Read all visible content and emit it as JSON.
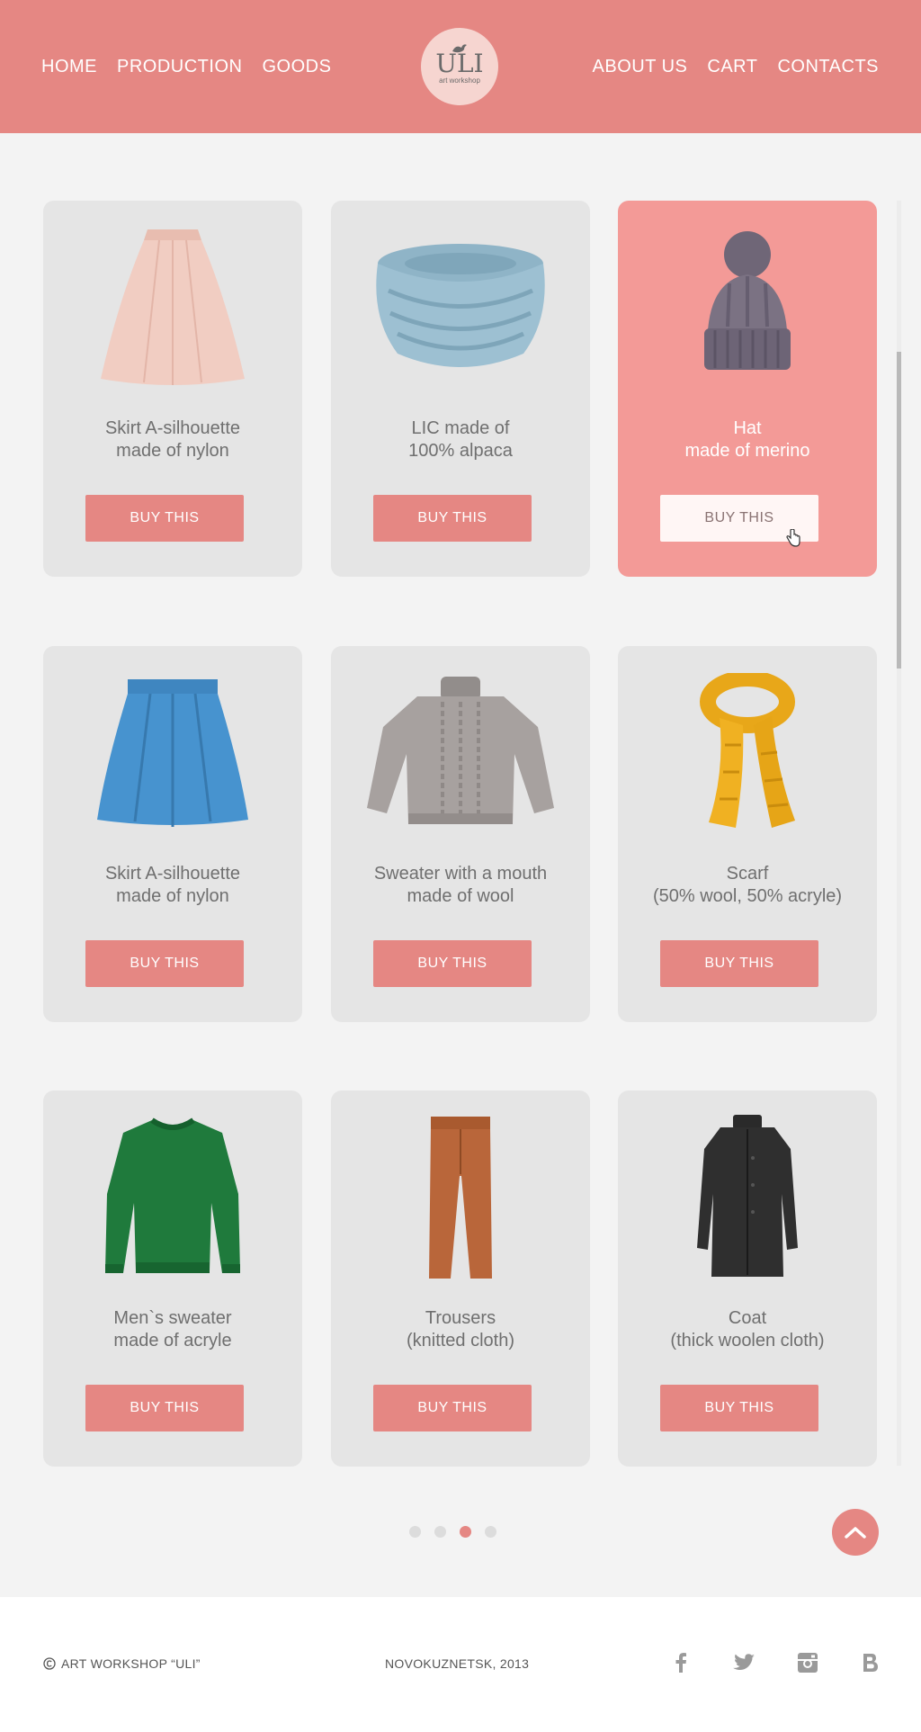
{
  "nav": {
    "left": [
      "HOME",
      "PRODUCTION",
      "GOODS"
    ],
    "right": [
      "ABOUT US",
      "CART",
      "CONTACTS"
    ]
  },
  "logo": {
    "mark": "ULI",
    "sub": "art workshop"
  },
  "products": [
    {
      "line1": "Skirt A-silhouette",
      "line2": "made of nylon",
      "button": "BUY THIS",
      "image": "pink-skirt"
    },
    {
      "line1": "LIC made of",
      "line2": "100% alpaca",
      "button": "BUY THIS",
      "image": "blue-snood"
    },
    {
      "line1": "Hat",
      "line2": "made of merino",
      "button": "BUY THIS",
      "image": "purple-hat"
    },
    {
      "line1": "Skirt A-silhouette",
      "line2": "made of nylon",
      "button": "BUY THIS",
      "image": "blue-skirt"
    },
    {
      "line1": "Sweater with a mouth",
      "line2": "made of wool",
      "button": "BUY THIS",
      "image": "grey-sweater"
    },
    {
      "line1": "Scarf",
      "line2": "(50% wool, 50% acryle)",
      "button": "BUY THIS",
      "image": "yellow-scarf"
    },
    {
      "line1": "Men`s sweater",
      "line2": "made of acryle",
      "button": "BUY THIS",
      "image": "green-sweater"
    },
    {
      "line1": "Trousers",
      "line2": "(knitted cloth)",
      "button": "BUY THIS",
      "image": "orange-trousers"
    },
    {
      "line1": "Coat",
      "line2": "(thick woolen cloth)",
      "button": "BUY THIS",
      "image": "black-coat"
    }
  ],
  "active_product_index": 2,
  "pagination": {
    "pages": 4,
    "current": 3
  },
  "footer": {
    "copyright": "ART WORKSHOP “ULI”",
    "city": "NOVOKUZNETSK, 2013",
    "social": [
      "facebook-icon",
      "twitter-icon",
      "instagram-icon",
      "vk-icon"
    ]
  },
  "colors": {
    "accent": "#e58783",
    "active_card": "#f39a97",
    "card": "#e5e5e5",
    "background": "#f3f3f3"
  }
}
